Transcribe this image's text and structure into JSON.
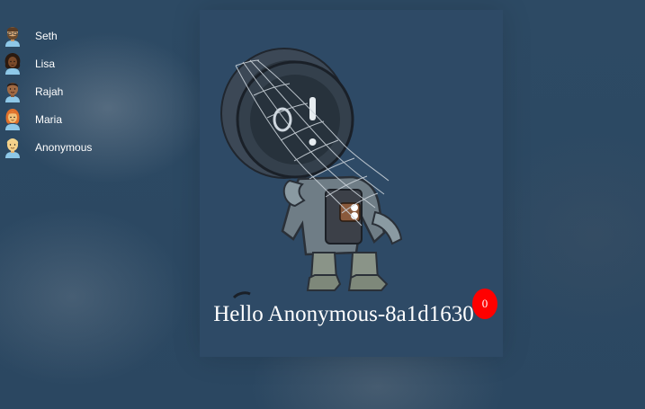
{
  "users": [
    {
      "name": "Seth",
      "avatar_icon": "man-with-beard-avatar-icon"
    },
    {
      "name": "Lisa",
      "avatar_icon": "woman-curly-hair-avatar-icon"
    },
    {
      "name": "Rajah",
      "avatar_icon": "man-brown-skin-avatar-icon"
    },
    {
      "name": "Maria",
      "avatar_icon": "woman-red-hair-avatar-icon"
    },
    {
      "name": "Anonymous",
      "avatar_icon": "blonde-person-avatar-icon"
    }
  ],
  "greeting": "Hello Anonymous-8a1d1630",
  "badge_count": "0",
  "colors": {
    "background": "#2c4862",
    "badge": "#ff0000",
    "text": "#ffffff"
  }
}
